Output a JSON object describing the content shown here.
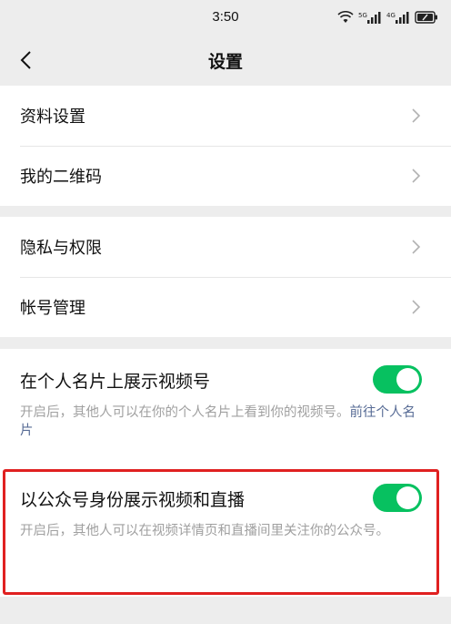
{
  "status_bar": {
    "time": "3:50",
    "icons": [
      "wifi-icon",
      "signal-5g-icon",
      "signal-4g-icon",
      "battery-icon"
    ],
    "signal_a_label": "5G",
    "signal_b_label": "4G"
  },
  "nav": {
    "title": "设置",
    "back_icon": "chevron-left-icon"
  },
  "group1": {
    "items": [
      {
        "label": "资料设置"
      },
      {
        "label": "我的二维码"
      }
    ]
  },
  "group2": {
    "items": [
      {
        "label": "隐私与权限"
      },
      {
        "label": "帐号管理"
      }
    ]
  },
  "toggles": {
    "show_channels_on_card": {
      "title": "在个人名片上展示视频号",
      "desc": "开启后，其他人可以在你的个人名片上看到你的视频号。",
      "link": "前往个人名片",
      "enabled": true
    },
    "show_as_official_account": {
      "title": "以公众号身份展示视频和直播",
      "desc": "开启后，其他人可以在视频详情页和直播间里关注你的公众号。",
      "enabled": true
    }
  },
  "colors": {
    "accent_green": "#07c160",
    "link_blue": "#576b95",
    "highlight_red": "#e02020",
    "background": "#ededed"
  }
}
